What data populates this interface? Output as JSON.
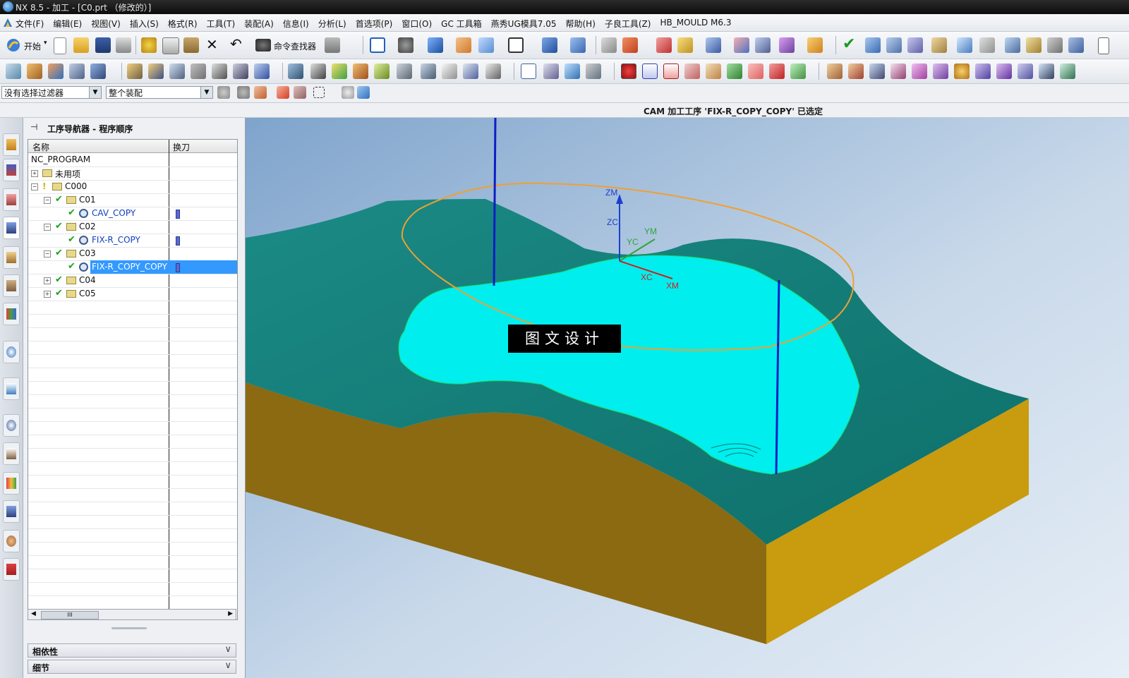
{
  "window": {
    "title": "NX 8.5 - 加工 - [C0.prt （修改的）]"
  },
  "menu": [
    "文件(F)",
    "编辑(E)",
    "视图(V)",
    "插入(S)",
    "格式(R)",
    "工具(T)",
    "装配(A)",
    "信息(I)",
    "分析(L)",
    "首选项(P)",
    "窗口(O)",
    "GC 工具箱",
    "燕秀UG模具7.05",
    "帮助(H)",
    "子良工具(Z)",
    "HB_MOULD M6.3"
  ],
  "toolbar": {
    "start_label": "开始",
    "command_finder_label": "命令查找器"
  },
  "selection_bar": {
    "filter_value": "没有选择过滤器",
    "assembly_value": "整个装配"
  },
  "status": {
    "message": "CAM 加工工序 'FIX-R_COPY_COPY' 已选定"
  },
  "navigator": {
    "title": "工序导航器 - 程序顺序",
    "col_name": "名称",
    "col_toolchange": "换刀",
    "rows": [
      "NC_PROGRAM",
      "未用项",
      "C000",
      "C01",
      "CAV_COPY",
      "C02",
      "FIX-R_COPY",
      "C03",
      "FIX-R_COPY_COPY",
      "C04",
      "C05"
    ],
    "scroll_thumb": "III",
    "sections": {
      "dependencies": "相依性",
      "details": "细节"
    }
  },
  "viewport": {
    "axis_labels": {
      "zm": "ZM",
      "zc": "ZC",
      "ym": "YM",
      "yc": "YC",
      "xc": "XC",
      "xm": "XM"
    },
    "watermark": "图文设计"
  },
  "colors": {
    "cavity": "#00eeee",
    "top_surface": "#127f7a",
    "side_brown": "#8b6a12",
    "side_gold": "#c99b0e",
    "toolpath": "#f0a030",
    "selection": "#3399ff"
  }
}
